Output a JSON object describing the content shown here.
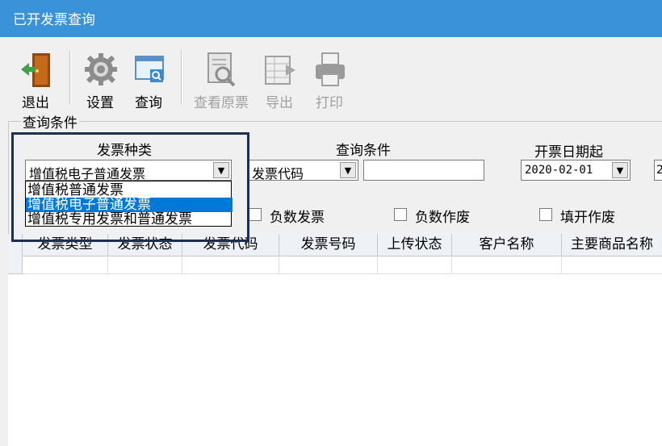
{
  "window": {
    "title": "已开发票查询"
  },
  "toolbar": {
    "exit": "退出",
    "settings": "设置",
    "query": "查询",
    "view_original": "查看原票",
    "export": "导出",
    "print": "打印"
  },
  "query_group": {
    "legend": "查询条件",
    "invoice_type_label": "发票种类",
    "invoice_type_value": "增值税电子普通发票",
    "invoice_type_options": [
      "增值税普通发票",
      "增值税电子普通发票",
      "增值税专用发票和普通发票"
    ],
    "selected_option_index": 1,
    "condition_label": "查询条件",
    "condition_value": "发票代码",
    "condition_input": "",
    "start_date_label": "开票日期起",
    "start_date_value": "2020-02-01",
    "end_date_partial": "2",
    "checkbox_negative_invoice": "负数发票",
    "checkbox_negative_void": "负数作废",
    "checkbox_fill_void": "填开作废"
  },
  "table": {
    "columns": [
      "发票类型",
      "发票状态",
      "发票代码",
      "发票号码",
      "上传状态",
      "客户名称",
      "主要商品名称"
    ]
  },
  "colors": {
    "titlebar": "#3a93d8",
    "selection": "#0078d7",
    "highlight_box": "#1d2e55"
  }
}
